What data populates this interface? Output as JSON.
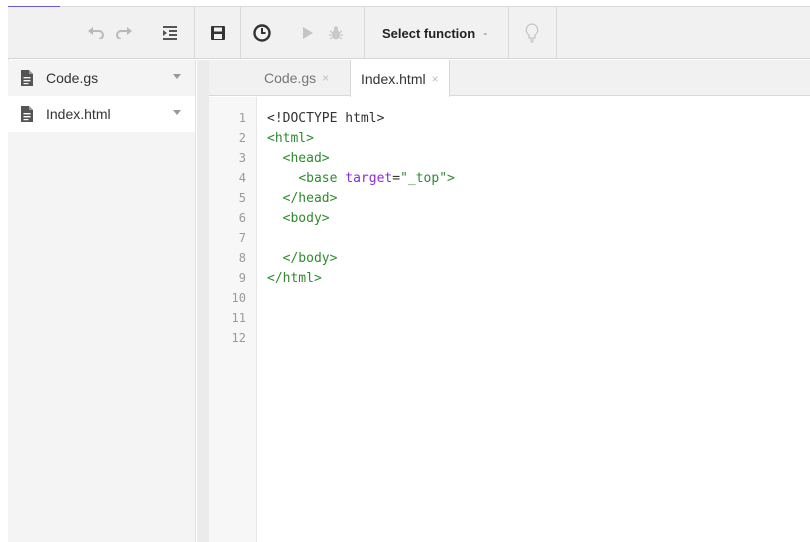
{
  "colors": {
    "accent": "#6a5acd",
    "tag": "#2e8b2e",
    "attr": "#8a2be2",
    "string": "#2e8b2e",
    "plain": "#333333"
  },
  "toolbar": {
    "undo_icon": "undo-icon",
    "redo_icon": "redo-icon",
    "indent_icon": "indent-icon",
    "save_icon": "save-icon",
    "triggers_icon": "clock-icon",
    "run_icon": "play-icon",
    "debug_icon": "bug-icon",
    "select_function_label": "Select function",
    "select_function_caret": "-",
    "hint_icon": "lightbulb-icon"
  },
  "sidebar": {
    "files": [
      {
        "name": "Code.gs",
        "active": false
      },
      {
        "name": "Index.html",
        "active": true
      }
    ]
  },
  "tabs": [
    {
      "label": "Code.gs",
      "close": "×",
      "active": false
    },
    {
      "label": "Index.html",
      "close": "×",
      "active": true
    }
  ],
  "editor": {
    "line_numbers": [
      "1",
      "2",
      "3",
      "4",
      "5",
      "6",
      "7",
      "8",
      "9",
      "10",
      "11",
      "12"
    ],
    "lines": [
      [
        {
          "t": "<!DOCTYPE html>",
          "k": "plain"
        }
      ],
      [
        {
          "t": "<html>",
          "k": "tag"
        }
      ],
      [
        {
          "t": "  ",
          "k": "plain"
        },
        {
          "t": "<head>",
          "k": "tag"
        }
      ],
      [
        {
          "t": "    ",
          "k": "plain"
        },
        {
          "t": "<base ",
          "k": "tag"
        },
        {
          "t": "target",
          "k": "attr"
        },
        {
          "t": "=",
          "k": "plain"
        },
        {
          "t": "\"_top\"",
          "k": "string"
        },
        {
          "t": ">",
          "k": "tag"
        }
      ],
      [
        {
          "t": "  ",
          "k": "plain"
        },
        {
          "t": "</head>",
          "k": "tag"
        }
      ],
      [
        {
          "t": "  ",
          "k": "plain"
        },
        {
          "t": "<body>",
          "k": "tag"
        }
      ],
      [
        {
          "t": "",
          "k": "plain"
        }
      ],
      [
        {
          "t": "  ",
          "k": "plain"
        },
        {
          "t": "</body>",
          "k": "tag"
        }
      ],
      [
        {
          "t": "</html>",
          "k": "tag"
        }
      ],
      [
        {
          "t": "",
          "k": "plain"
        }
      ],
      [
        {
          "t": "",
          "k": "plain"
        }
      ],
      [
        {
          "t": "",
          "k": "plain"
        }
      ]
    ]
  }
}
